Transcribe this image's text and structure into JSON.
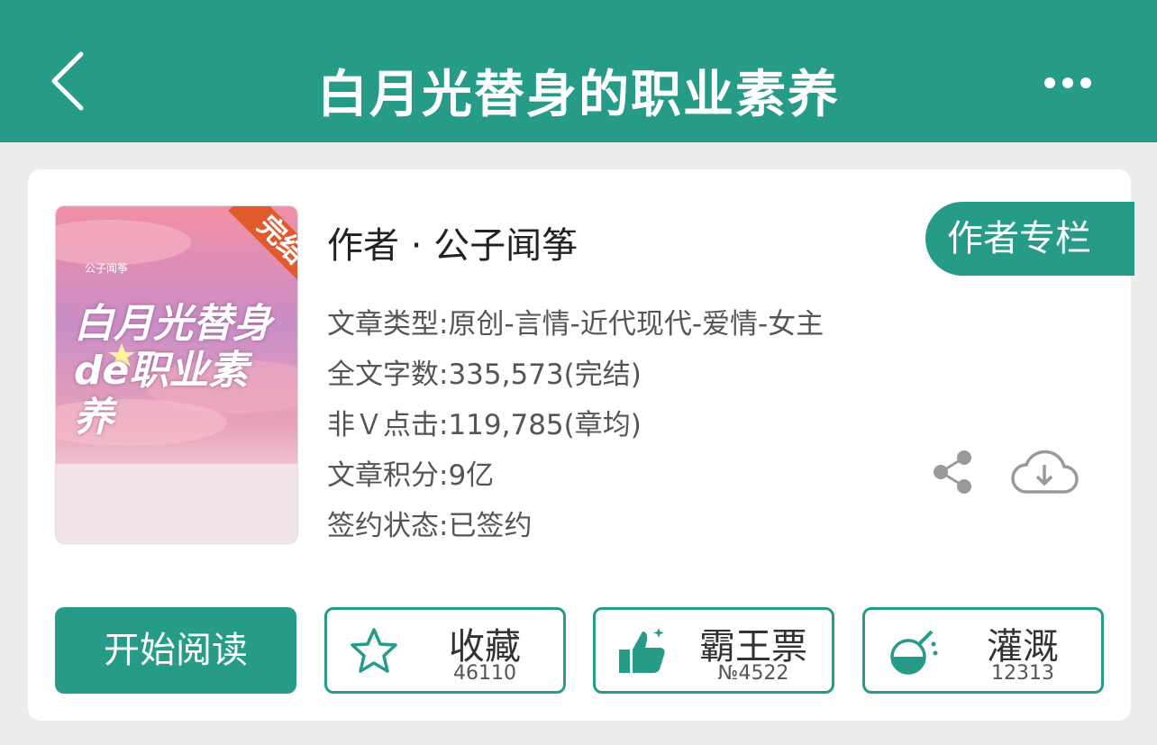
{
  "header": {
    "title": "白月光替身的职业素养",
    "back_icon": "chevron-left-icon",
    "more_icon": "more-dots-icon",
    "bg_color": "#269b88"
  },
  "book": {
    "cover": {
      "badge": "完结",
      "author_small": "公子闻筝",
      "title_art": "白月光替身de职业素养"
    },
    "author_line": "作者 · 公子闻筝",
    "author_column_label": "作者专栏",
    "info": [
      "文章类型:原创-言情-近代现代-爱情-女主",
      "全文字数:335,573(完结)",
      "非Ｖ点击:119,785(章均)",
      "文章积分:9亿",
      "签约状态:已签约"
    ],
    "share_icon": "share-icon",
    "download_icon": "cloud-download-icon"
  },
  "actions": {
    "read_label": "开始阅读",
    "favorite": {
      "label": "收藏",
      "count": "46110",
      "icon": "star-icon"
    },
    "ticket": {
      "label": "霸王票",
      "count": "№4522",
      "icon": "thumbs-up-icon"
    },
    "water": {
      "label": "灌溉",
      "count": "12313",
      "icon": "watering-flask-icon"
    }
  },
  "colors": {
    "accent": "#269b88",
    "badge": "#e05a2e"
  }
}
